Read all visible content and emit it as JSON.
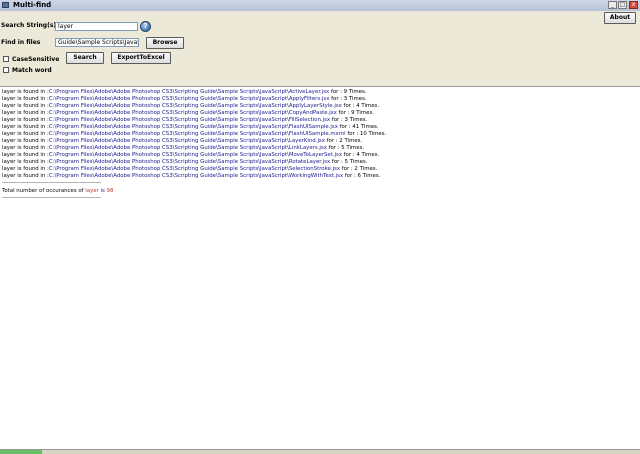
{
  "window": {
    "title": "Multi-find",
    "buttons": [
      "_",
      "□",
      "x"
    ]
  },
  "about_label": "About",
  "form": {
    "search_label": "Search String(s)",
    "search_value": "layer",
    "help_icon_glyph": "?",
    "find_label": "Find in files",
    "find_value": "Guide\\Sample Scripts\\JavaScript",
    "browse_label": "Browse",
    "case_label": "CaseSensitive",
    "match_label": "Match word",
    "search_button": "Search",
    "export_button": "ExportToExcel"
  },
  "results": {
    "prefix": "layer is found in :",
    "base_path": "C:\\Program Files\\Adobe\\Adobe Photoshop CS3\\Scripting Guide\\Sample Scripts\\JavaScript\\",
    "rows": [
      {
        "file": "ActiveLayer.jsx",
        "suffix": "for : 9 Times."
      },
      {
        "file": "ApplyFilters.jsx",
        "suffix": "for : 3 Times."
      },
      {
        "file": "ApplyLayerStyle.jsx",
        "suffix": "for : 4 Times."
      },
      {
        "file": "CopyAndPaste.jsx",
        "suffix": "for : 9 Times."
      },
      {
        "file": "FillSelection.jsx",
        "suffix": "for : 3 Times."
      },
      {
        "file": "FlashUISample.jsx",
        "suffix": "for : 41 Times."
      },
      {
        "file": "FlashUISample.mxml",
        "suffix": "for : 10 Times."
      },
      {
        "file": "LayerKind.jsx",
        "suffix": "for : 2 Times."
      },
      {
        "file": "LinkLayers.jsx",
        "suffix": "for : 5 Times."
      },
      {
        "file": "MoveToLayerSet.jsx",
        "suffix": "for : 4 Times."
      },
      {
        "file": "RotateLayer.jsx",
        "suffix": "for : 5 Times."
      },
      {
        "file": "SelectionStroke.jsx",
        "suffix": "for : 2 Times."
      },
      {
        "file": "WorkingWithText.jsx",
        "suffix": "for : 6 Times."
      }
    ],
    "separator": "------------------------------------------------------------",
    "total_prefix": "Total number of occurances of",
    "total_term": "layer",
    "total_is": "is",
    "total_value": "98",
    "separator2": "------------------------------------------------------------"
  }
}
